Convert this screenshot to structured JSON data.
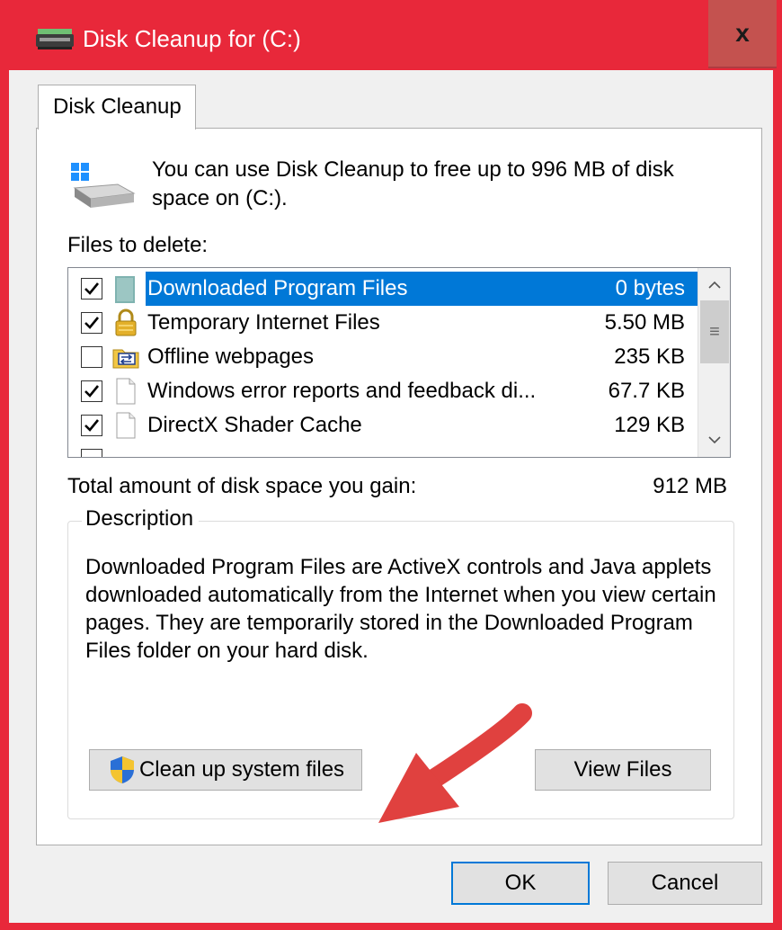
{
  "window": {
    "title": "Disk Cleanup for  (C:)",
    "close_label": "x",
    "accent_color": "#e8283a"
  },
  "tab": {
    "label": "Disk Cleanup"
  },
  "intro": {
    "text": "You can use Disk Cleanup to free up to 996 MB of disk space on  (C:)."
  },
  "files_to_delete": {
    "label": "Files to delete:",
    "items": [
      {
        "label": "Downloaded Program Files",
        "size": "0 bytes",
        "checked": true,
        "selected": true,
        "icon": "folder-icon"
      },
      {
        "label": "Temporary Internet Files",
        "size": "5.50 MB",
        "checked": true,
        "selected": false,
        "icon": "lock-icon"
      },
      {
        "label": "Offline webpages",
        "size": "235 KB",
        "checked": false,
        "selected": false,
        "icon": "sync-folder-icon"
      },
      {
        "label": "Windows error reports and feedback di...",
        "size": "67.7 KB",
        "checked": true,
        "selected": false,
        "icon": "file-icon"
      },
      {
        "label": "DirectX Shader Cache",
        "size": "129 KB",
        "checked": true,
        "selected": false,
        "icon": "file-icon"
      }
    ],
    "scroll_up": "^",
    "scroll_down": "v",
    "scroll_thumb": "≡"
  },
  "total": {
    "label": "Total amount of disk space you gain:",
    "value": "912 MB"
  },
  "description": {
    "legend": "Description",
    "text": "Downloaded Program Files are ActiveX controls and Java applets downloaded automatically from the Internet when you view certain pages. They are temporarily stored in the Downloaded Program Files folder on your hard disk."
  },
  "buttons": {
    "cleanup_system": "Clean up system files",
    "view_files": "View Files",
    "ok": "OK",
    "cancel": "Cancel"
  },
  "colors": {
    "selection": "#0078d7",
    "dialog_bg": "#f0f0f0",
    "arrow": "#e0413f"
  }
}
